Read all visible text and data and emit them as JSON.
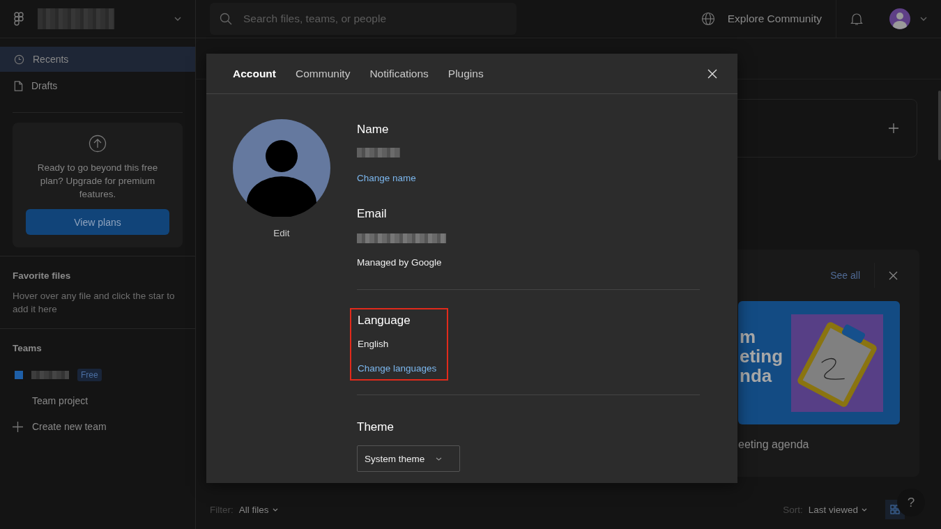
{
  "topbar": {
    "search_placeholder": "Search files, teams, or people",
    "explore": "Explore Community"
  },
  "sidebar": {
    "nav": [
      {
        "label": "Recents",
        "selected": true
      },
      {
        "label": "Drafts",
        "selected": false
      }
    ],
    "upgrade": {
      "text": "Ready to go beyond this free plan? Upgrade for premium features.",
      "button": "View plans"
    },
    "favorites": {
      "title": "Favorite files",
      "hint": "Hover over any file and click the star to add it here"
    },
    "teams": {
      "title": "Teams",
      "team": {
        "badge": "Free",
        "color": "#1e5fa8"
      },
      "items": [
        {
          "label": "Team project",
          "kind": "project"
        },
        {
          "label": "Create new team",
          "kind": "create"
        }
      ]
    }
  },
  "main": {
    "see_all": "See all",
    "thumbnail_text": [
      "m",
      "eting",
      "nda"
    ],
    "file_name": "eeting agenda",
    "filter": {
      "label": "Filter:",
      "value": "All files"
    },
    "sort": {
      "label": "Sort:",
      "value": "Last viewed"
    },
    "help": "?"
  },
  "modal": {
    "tabs": [
      {
        "label": "Account",
        "selected": true
      },
      {
        "label": "Community",
        "selected": false
      },
      {
        "label": "Notifications",
        "selected": false
      },
      {
        "label": "Plugins",
        "selected": false
      }
    ],
    "avatar_edit": "Edit",
    "sections": [
      {
        "kind": "name",
        "title": "Name",
        "link": "Change name"
      },
      {
        "kind": "email",
        "title": "Email",
        "note": "Managed by Google"
      },
      {
        "kind": "language",
        "title": "Language",
        "value": "English",
        "link": "Change languages",
        "highlighted": true
      },
      {
        "kind": "theme",
        "title": "Theme",
        "select": "System theme"
      }
    ]
  }
}
